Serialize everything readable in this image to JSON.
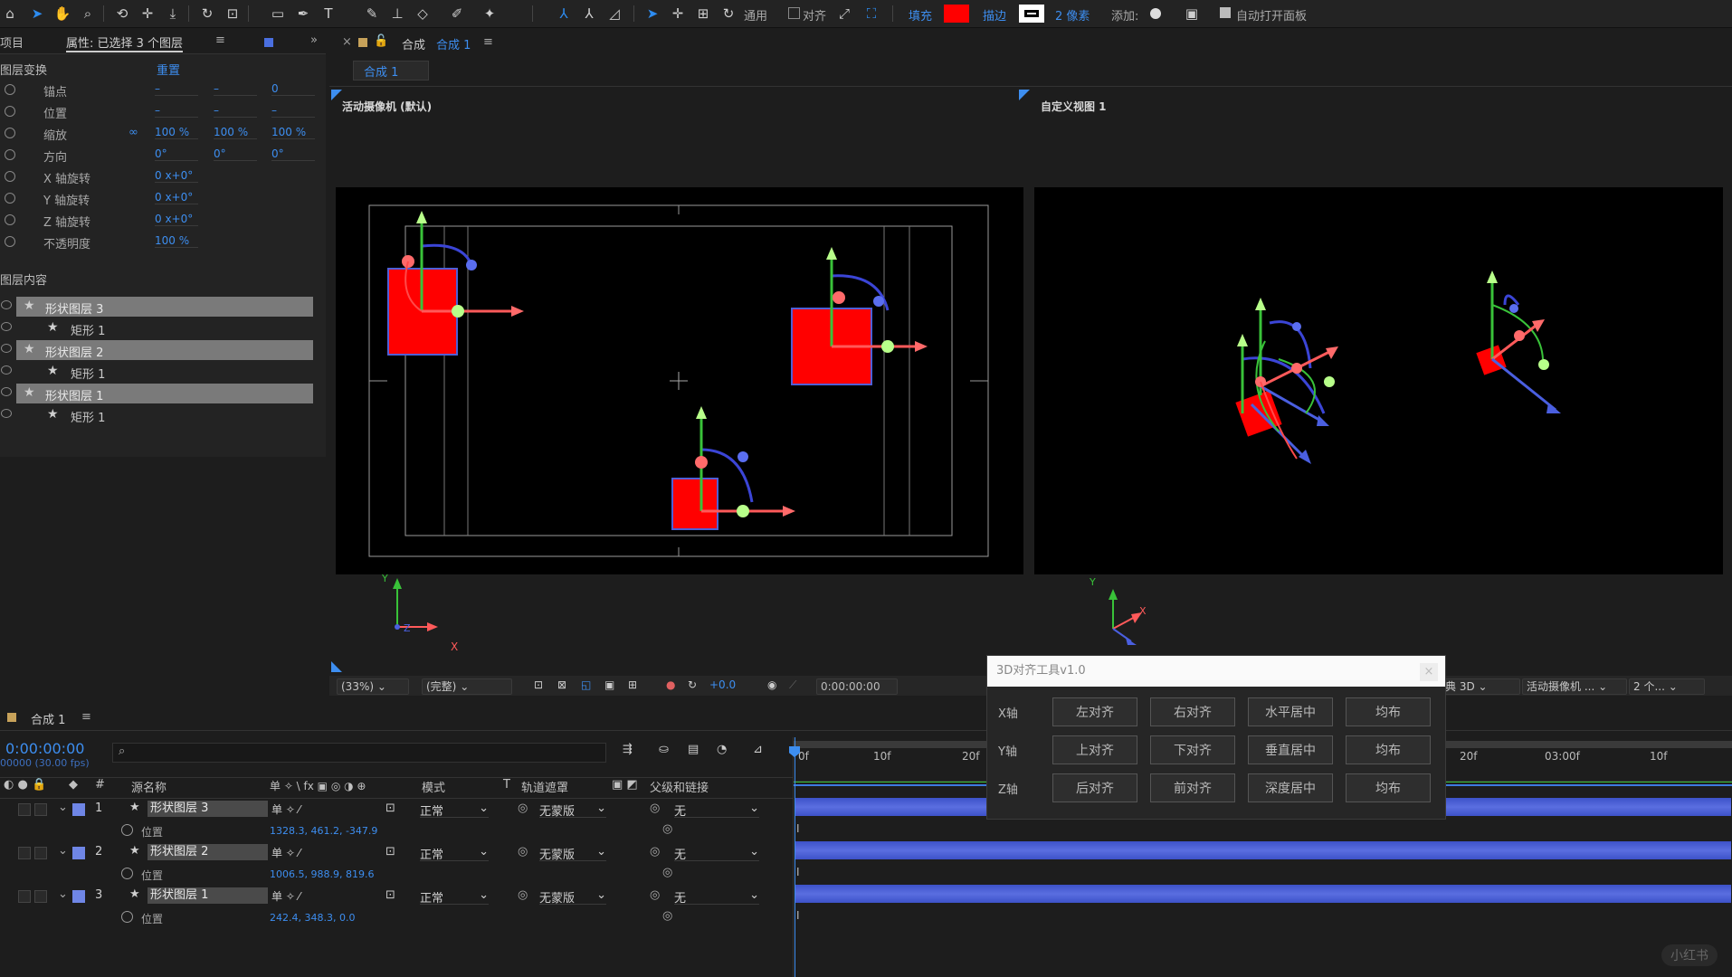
{
  "toolbar": {
    "general_label": "通用",
    "align_label": "对齐",
    "fill_label": "填充",
    "fill_color": "#ff0000",
    "stroke_label": "描边",
    "stroke_px": "2 像素",
    "add_label": "添加:",
    "auto_open_label": "自动打开面板"
  },
  "left_panel": {
    "project_tab": "项目",
    "props_tab": "属性: 已选择 3 个图层",
    "transform_header": "图层变换",
    "reset_label": "重置",
    "properties": [
      {
        "label": "锚点",
        "values": [
          "–",
          "–",
          "0"
        ]
      },
      {
        "label": "位置",
        "values": [
          "–",
          "–",
          "–"
        ]
      },
      {
        "label": "缩放",
        "values": [
          "100 %",
          "100 %",
          "100 %"
        ]
      },
      {
        "label": "方向",
        "values": [
          "0°",
          "0°",
          "0°"
        ]
      },
      {
        "label": "X 轴旋转",
        "values": [
          "0 x+0°"
        ]
      },
      {
        "label": "Y 轴旋转",
        "values": [
          "0 x+0°"
        ]
      },
      {
        "label": "Z 轴旋转",
        "values": [
          "0 x+0°"
        ]
      },
      {
        "label": "不透明度",
        "values": [
          "100 %"
        ]
      }
    ],
    "content_header": "图层内容",
    "layers": [
      {
        "name": "形状图层 3",
        "selected": true,
        "indent": 0
      },
      {
        "name": "矩形 1",
        "selected": false,
        "indent": 1
      },
      {
        "name": "形状图层 2",
        "selected": true,
        "indent": 0
      },
      {
        "name": "矩形 1",
        "selected": false,
        "indent": 1
      },
      {
        "name": "形状图层 1",
        "selected": true,
        "indent": 0
      },
      {
        "name": "矩形 1",
        "selected": false,
        "indent": 1
      }
    ]
  },
  "comp": {
    "tab_label": "合成",
    "comp_name": "合成 1",
    "sub_tab": "合成 1",
    "view_left_title": "活动摄像机 (默认)",
    "view_right_title": "自定义视图 1",
    "axis_x": "X",
    "axis_y": "Y",
    "axis_z": "Z",
    "zoom": "(33%)",
    "quality": "(完整)",
    "exposure": "+0.0",
    "timecode": "0:00:00:00",
    "renderer": "经典 3D",
    "camera": "活动摄像机 ...",
    "views": "2 个..."
  },
  "timeline": {
    "tab": "合成 1",
    "timecode": "0:00:00:00",
    "fps": "00000 (30.00 fps)",
    "search_placeholder": "",
    "col_source": "源名称",
    "col_mode": "模式",
    "col_t": "T",
    "col_track": "轨道遮罩",
    "col_parent": "父级和链接",
    "ruler": [
      "0f",
      "10f",
      "20f",
      "20f",
      "03:00f",
      "10f"
    ],
    "rows": [
      {
        "num": "1",
        "name": "形状图层 3",
        "mode": "正常",
        "mask": "无蒙版",
        "parent": "无",
        "prop": "位置",
        "pos": "1328.3, 461.2, -347.9"
      },
      {
        "num": "2",
        "name": "形状图层 2",
        "mode": "正常",
        "mask": "无蒙版",
        "parent": "无",
        "prop": "位置",
        "pos": "1006.5, 988.9, 819.6"
      },
      {
        "num": "3",
        "name": "形状图层 1",
        "mode": "正常",
        "mask": "无蒙版",
        "parent": "无",
        "prop": "位置",
        "pos": "242.4, 348.3, 0.0"
      }
    ]
  },
  "dialog": {
    "title": "3D对齐工具v1.0",
    "rows": [
      {
        "axis": "X轴",
        "buttons": [
          "左对齐",
          "右对齐",
          "水平居中",
          "均布"
        ]
      },
      {
        "axis": "Y轴",
        "buttons": [
          "上对齐",
          "下对齐",
          "垂直居中",
          "均布"
        ]
      },
      {
        "axis": "Z轴",
        "buttons": [
          "后对齐",
          "前对齐",
          "深度居中",
          "均布"
        ]
      }
    ]
  },
  "watermark": "小红书"
}
